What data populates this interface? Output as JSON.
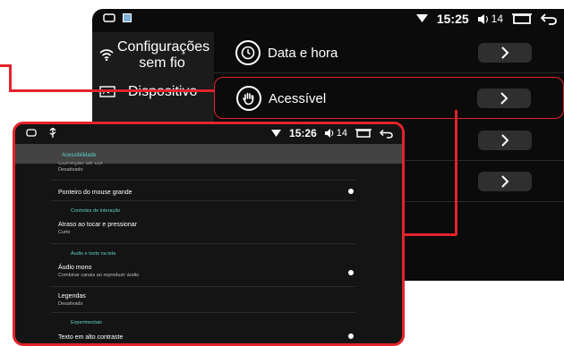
{
  "back_screen": {
    "status": {
      "time": "15:25",
      "volume": "14"
    },
    "sidebar": [
      {
        "label": "Configurações sem fio",
        "icon": "wifi-icon"
      },
      {
        "label": "Dispositivo",
        "icon": "device-icon"
      }
    ],
    "settings": [
      {
        "label": "Data e hora",
        "icon": "clock-icon"
      },
      {
        "label": "Acessível",
        "icon": "hand-icon"
      },
      {
        "label": "",
        "icon": ""
      },
      {
        "label": "",
        "icon": ""
      }
    ]
  },
  "front_screen": {
    "status": {
      "time": "15:26",
      "volume": "14"
    },
    "header": "Acessibilidade",
    "partial_item": {
      "title": "Correção de cor",
      "subtitle": "Desativado"
    },
    "items": [
      {
        "title": "Ponteiro do mouse grande",
        "subtitle": ""
      },
      {
        "title": "Atraso ao tocar e pressionar",
        "subtitle": "Curto"
      },
      {
        "title": "Áudio mono",
        "subtitle": "Combinar canais ao reproduzir áudio"
      },
      {
        "title": "Legendas",
        "subtitle": "Desativado"
      },
      {
        "title": "Texto em alto contraste",
        "subtitle": ""
      }
    ],
    "categories": [
      "Controles de interação",
      "Áudio e texto na tela",
      "Experimentais"
    ]
  },
  "colors": {
    "highlight": "#e3232b",
    "accent": "#5fd2c8"
  }
}
